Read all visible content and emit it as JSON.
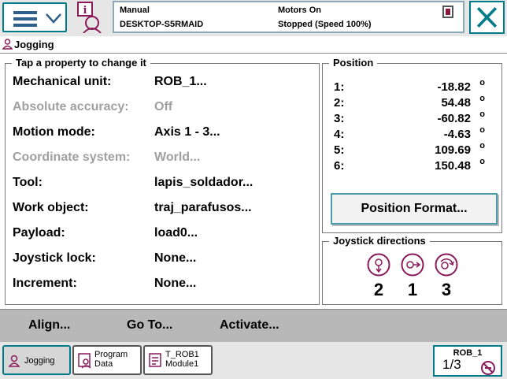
{
  "status": {
    "mode": "Manual",
    "host": "DESKTOP-S5RMAID",
    "motors": "Motors On",
    "state": "Stopped (Speed 100%)"
  },
  "page": {
    "title": "Jogging"
  },
  "properties": {
    "legend": "Tap a property to change it",
    "items": [
      {
        "label": "Mechanical unit:",
        "value": "ROB_1...",
        "enabled": true
      },
      {
        "label": "Absolute accuracy:",
        "value": "Off",
        "enabled": false
      },
      {
        "label": "Motion mode:",
        "value": "Axis 1 - 3...",
        "enabled": true
      },
      {
        "label": "Coordinate system:",
        "value": "World...",
        "enabled": false
      },
      {
        "label": "Tool:",
        "value": "lapis_soldador...",
        "enabled": true
      },
      {
        "label": "Work object:",
        "value": "traj_parafusos...",
        "enabled": true
      },
      {
        "label": "Payload:",
        "value": "load0...",
        "enabled": true
      },
      {
        "label": "Joystick lock:",
        "value": "None...",
        "enabled": true
      },
      {
        "label": "Increment:",
        "value": "None...",
        "enabled": true
      }
    ]
  },
  "position": {
    "legend": "Position",
    "unit": "o",
    "rows": [
      {
        "axis": "1:",
        "value": "-18.82"
      },
      {
        "axis": "2:",
        "value": "54.48"
      },
      {
        "axis": "3:",
        "value": "-60.82"
      },
      {
        "axis": "4:",
        "value": "-4.63"
      },
      {
        "axis": "5:",
        "value": "109.69"
      },
      {
        "axis": "6:",
        "value": "150.48"
      }
    ],
    "format_button": "Position Format..."
  },
  "joystick": {
    "legend": "Joystick directions",
    "numbers": [
      "2",
      "1",
      "3"
    ]
  },
  "actions": {
    "align": "Align...",
    "goto": "Go To...",
    "activate": "Activate..."
  },
  "tasks": {
    "jogging": "Jogging",
    "program_line1": "Program",
    "program_line2": "Data",
    "trob_line1": "T_ROB1",
    "trob_line2": "Module1"
  },
  "robot": {
    "name": "ROB_1",
    "fraction_num": "1",
    "fraction_den": "3"
  },
  "colors": {
    "accent": "#007b8a",
    "icon": "#8a1a5a"
  }
}
